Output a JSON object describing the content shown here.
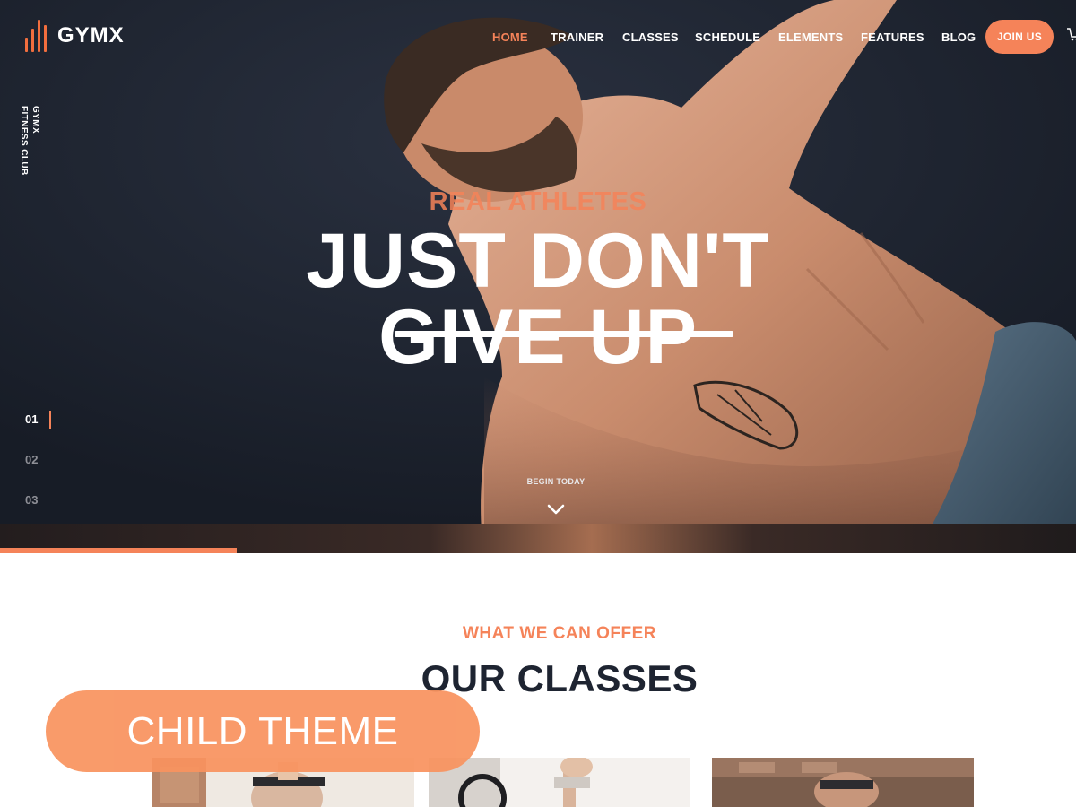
{
  "brand": {
    "name": "GYMX",
    "accent": "#f58359",
    "dark": "#1e2431"
  },
  "nav": {
    "items": [
      {
        "label": "HOME",
        "active": true
      },
      {
        "label": "TRAINER"
      },
      {
        "label": "CLASSES"
      },
      {
        "label": "SCHEDULE"
      },
      {
        "label": "ELEMENTS"
      },
      {
        "label": "FEATURES"
      },
      {
        "label": "BLOG"
      }
    ],
    "join_label": "JOIN US",
    "cart_icon": "cart-icon"
  },
  "side": {
    "line1": "GYMX",
    "line2": "FITNESS CLUB"
  },
  "slider": {
    "numbers": [
      "01",
      "02",
      "03"
    ],
    "active_index": 0,
    "progress_fraction": 0.22
  },
  "hero": {
    "kicker": "REAL ATHLETES",
    "title_line1": "JUST DON'T",
    "title_line2": "GIVE UP",
    "cta": "BEGIN TODAY",
    "cta_icon": "chevron-down-icon"
  },
  "classes": {
    "kicker": "WHAT WE CAN OFFER",
    "title": "OUR CLASSES"
  },
  "badge": {
    "label": "CHILD THEME"
  }
}
